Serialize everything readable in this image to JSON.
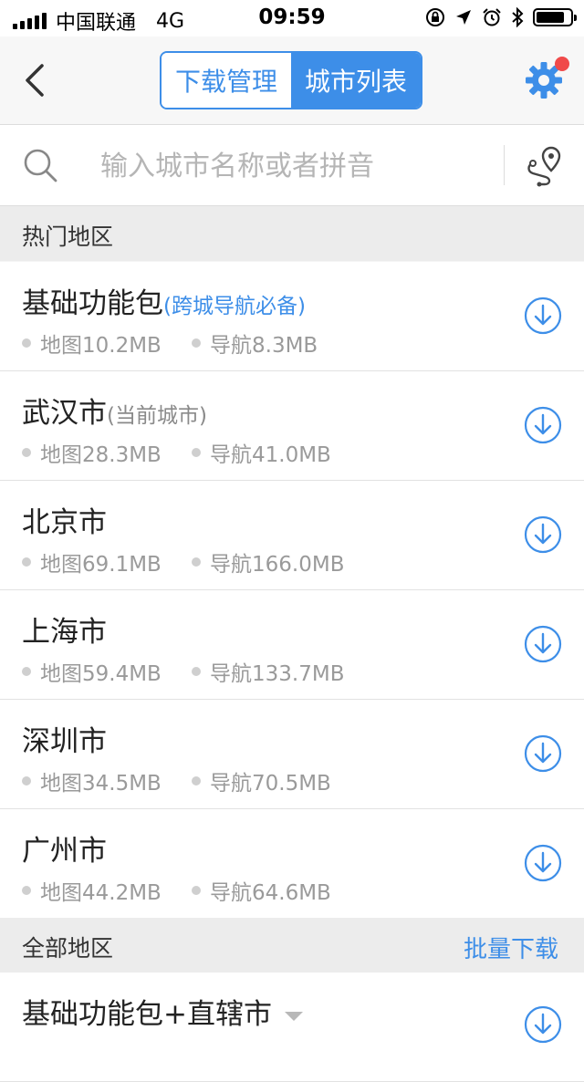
{
  "status_bar": {
    "carrier": "中国联通",
    "network": "4G",
    "time": "09:59",
    "battery_level": 0.85
  },
  "nav": {
    "tabs": [
      {
        "label": "下载管理",
        "active": false
      },
      {
        "label": "城市列表",
        "active": true
      }
    ],
    "accent_color": "#3d8ee8",
    "notification_dot_color": "#f04a4a"
  },
  "search": {
    "placeholder": "输入城市名称或者拼音",
    "value": ""
  },
  "hot_section": {
    "label": "热门地区",
    "items": [
      {
        "name": "基础功能包",
        "note": "(跨城导航必备)",
        "map": "地图10.2MB",
        "nav": "导航8.3MB"
      },
      {
        "name": "武汉市",
        "note": "(当前城市)",
        "map": "地图28.3MB",
        "nav": "导航41.0MB"
      },
      {
        "name": "北京市",
        "note": "",
        "map": "地图69.1MB",
        "nav": "导航166.0MB"
      },
      {
        "name": "上海市",
        "note": "",
        "map": "地图59.4MB",
        "nav": "导航133.7MB"
      },
      {
        "name": "深圳市",
        "note": "",
        "map": "地图34.5MB",
        "nav": "导航70.5MB"
      },
      {
        "name": "广州市",
        "note": "",
        "map": "地图44.2MB",
        "nav": "导航64.6MB"
      }
    ]
  },
  "all_section": {
    "label": "全部地区",
    "action": "批量下载",
    "items": [
      {
        "name": "基础功能包+直辖市"
      }
    ]
  }
}
